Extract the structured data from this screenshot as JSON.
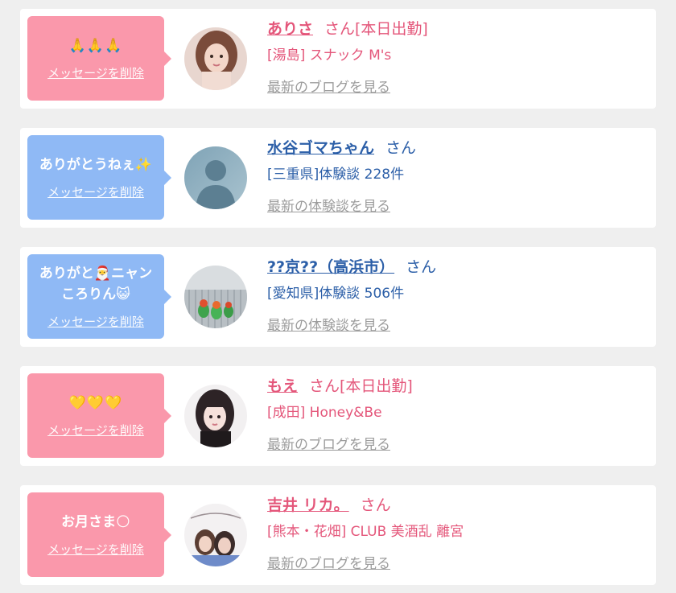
{
  "items": [
    {
      "message": "🙏🙏🙏",
      "delete_label": "メッセージを削除",
      "name": "ありさ",
      "suffix": "さん[本日出勤]",
      "detail": "[湯島] スナック M's",
      "more_label": "最新のブログを見る",
      "theme": "pink",
      "avatar_icon": "girl-photo"
    },
    {
      "message": "ありがとうねぇ✨",
      "delete_label": "メッセージを削除",
      "name": "水谷ゴマちゃん",
      "suffix": "さん",
      "detail": "[三重県]体験談 228件",
      "more_label": "最新の体験談を見る",
      "theme": "blue",
      "avatar_icon": "no-photo"
    },
    {
      "message": "ありがと🎅ニャン\nころりん😺",
      "delete_label": "メッセージを削除",
      "name": "??京??（高浜市）",
      "suffix": "さん",
      "detail": "[愛知県]体験談 506件",
      "more_label": "最新の体験談を見る",
      "theme": "blue",
      "avatar_icon": "parrots-photo"
    },
    {
      "message": "💛💛💛",
      "delete_label": "メッセージを削除",
      "name": "もえ",
      "suffix": "さん[本日出勤]",
      "detail": "[成田] Honey&Be",
      "more_label": "最新のブログを見る",
      "theme": "pink",
      "avatar_icon": "girl-photo"
    },
    {
      "message": "お月さま🌕",
      "delete_label": "メッセージを削除",
      "name": "吉井 リカ。",
      "suffix": "さん",
      "detail": "[熊本・花畑] CLUB 美酒乱 離宮",
      "more_label": "最新のブログを見る",
      "theme": "pink",
      "avatar_icon": "group-photo"
    }
  ],
  "colors": {
    "pink_bubble": "#fa98ab",
    "blue_bubble": "#8fb9f5",
    "pink_text": "#e4567a",
    "blue_text": "#2c5fa8",
    "link_gray": "#9c9c9c"
  }
}
